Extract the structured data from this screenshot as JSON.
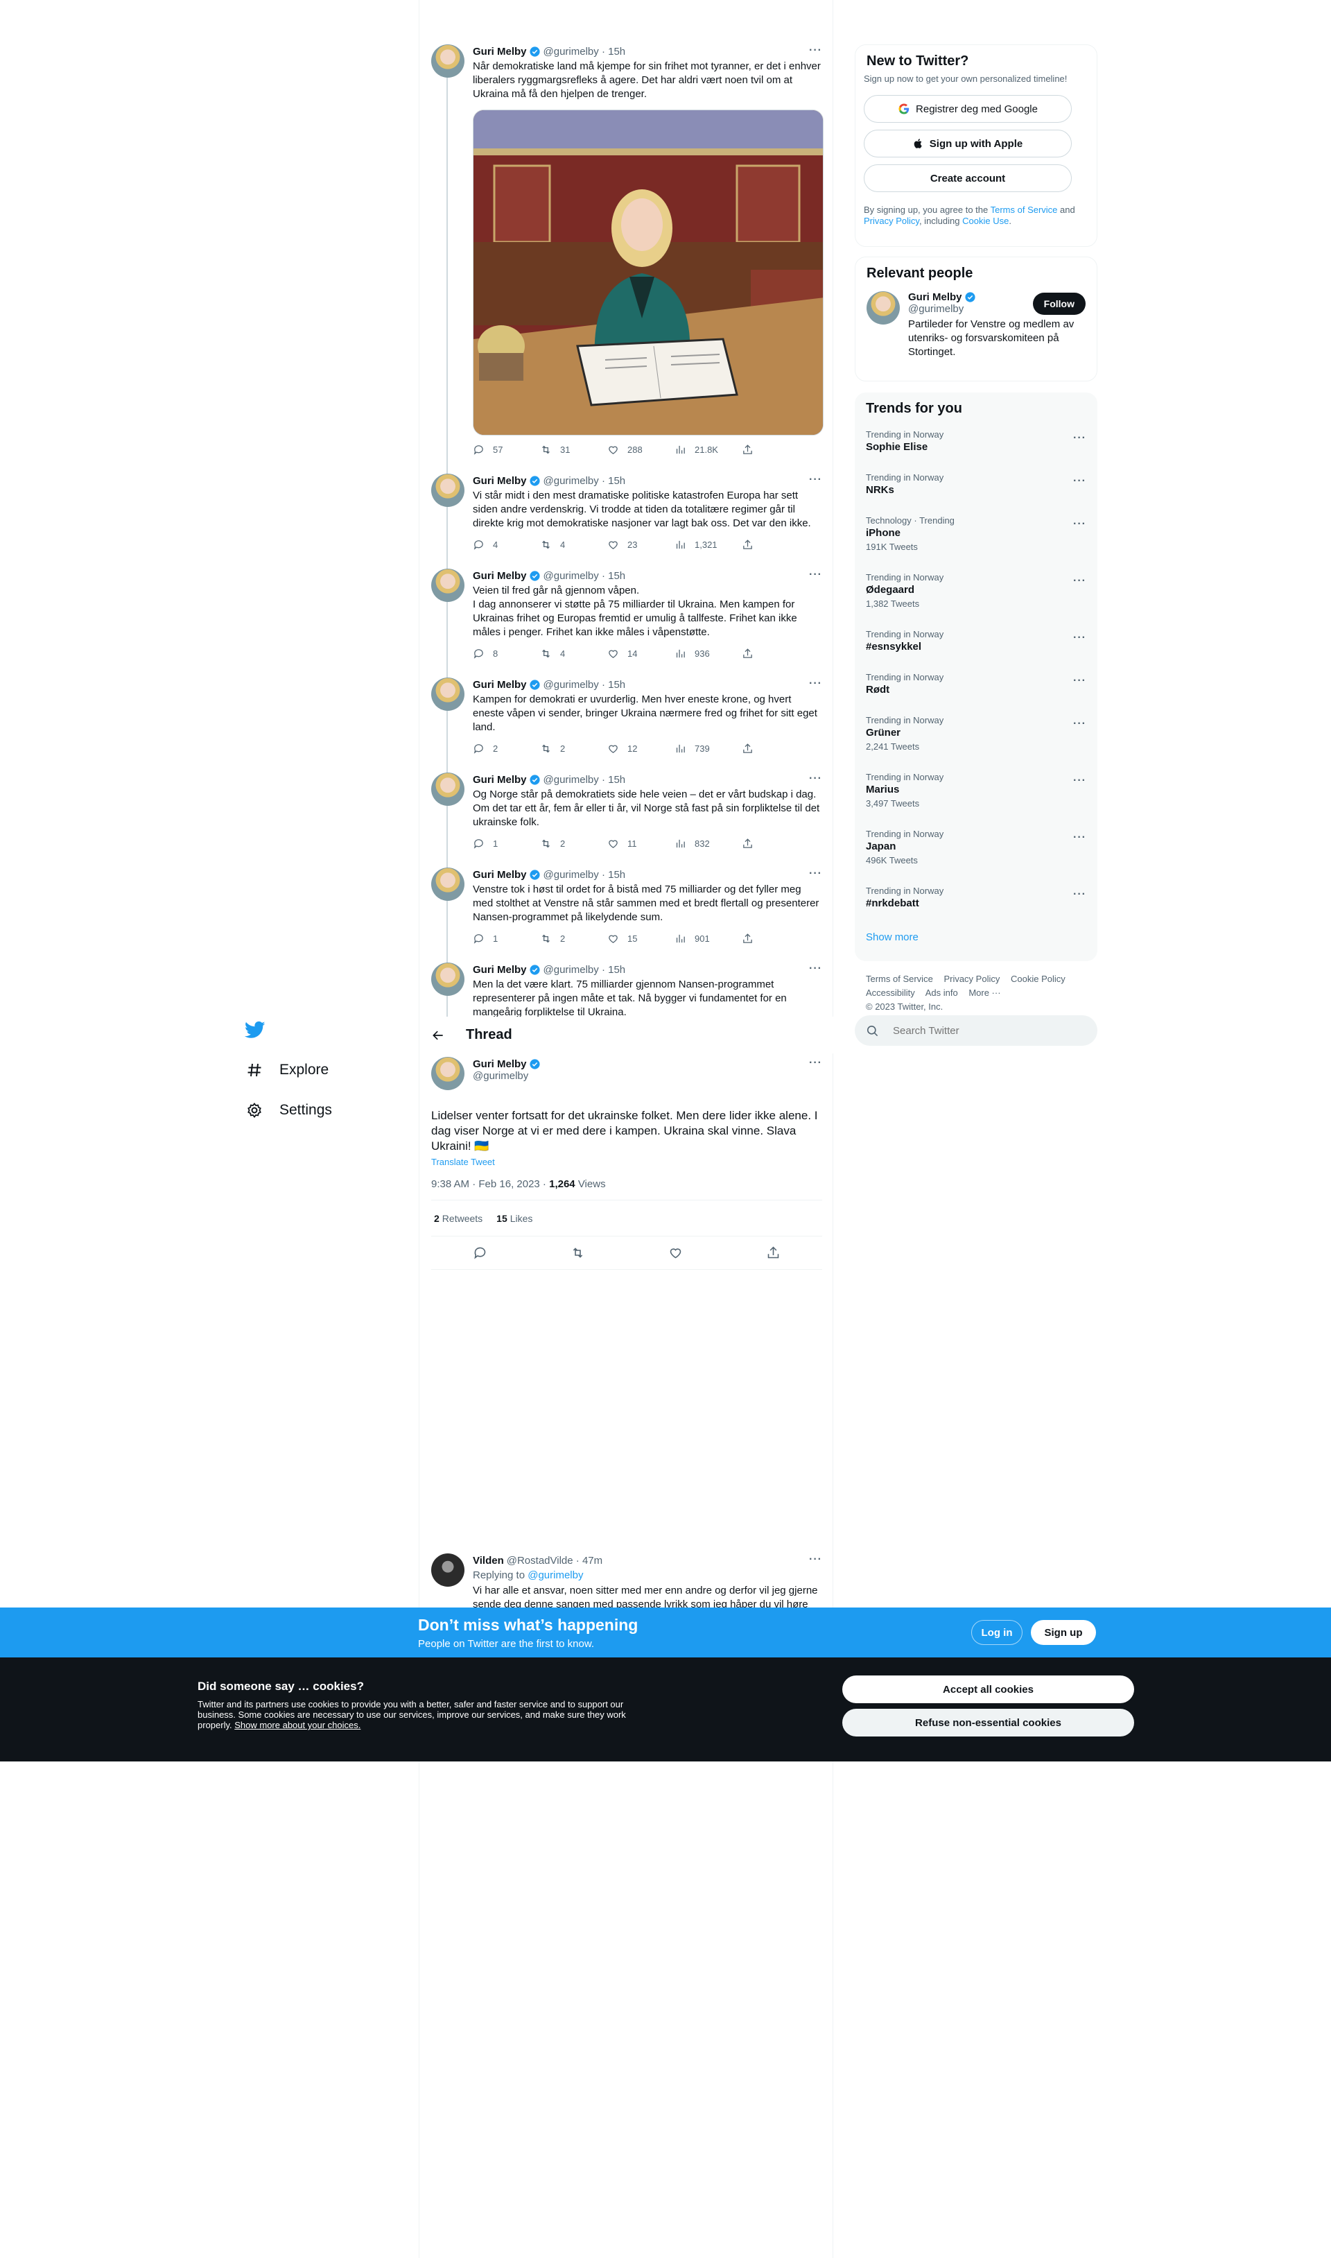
{
  "nav": {
    "items": [
      {
        "label": "Explore",
        "icon": "hashtag-icon"
      },
      {
        "label": "Settings",
        "icon": "gear-icon"
      }
    ]
  },
  "thread_tweets": [
    {
      "name": "Guri Melby",
      "handle": "@gurimelby",
      "time": "15h",
      "text": "Når demokratiske land må kjempe for sin frihet mot tyranner, er det i enhver liberalers ryggmargsrefleks å agere. Det har aldri vært noen tvil om at Ukraina må få den hjelpen de trenger.",
      "replies": "57",
      "retweets": "31",
      "likes": "288",
      "views": "21.8K",
      "has_photo": true
    },
    {
      "name": "Guri Melby",
      "handle": "@gurimelby",
      "time": "15h",
      "text": "Vi står midt i den mest dramatiske politiske katastrofen Europa har sett siden andre verdenskrig. Vi trodde at tiden da totalitære regimer går til direkte krig mot demokratiske nasjoner var lagt bak oss. Det var den ikke.",
      "replies": "4",
      "retweets": "4",
      "likes": "23",
      "views": "1,321"
    },
    {
      "name": "Guri Melby",
      "handle": "@gurimelby",
      "time": "15h",
      "text": "Veien til fred går nå gjennom våpen.\nI dag annonserer vi støtte på 75 milliarder til Ukraina. Men kampen for Ukrainas frihet og Europas fremtid er umulig å tallfeste. Frihet kan ikke måles i penger. Frihet kan ikke måles i våpenstøtte.",
      "replies": "8",
      "retweets": "4",
      "likes": "14",
      "views": "936"
    },
    {
      "name": "Guri Melby",
      "handle": "@gurimelby",
      "time": "15h",
      "text": "Kampen for demokrati er uvurderlig. Men hver eneste krone, og hvert eneste våpen vi sender, bringer Ukraina nærmere fred og frihet for sitt eget land.",
      "replies": "2",
      "retweets": "2",
      "likes": "12",
      "views": "739"
    },
    {
      "name": "Guri Melby",
      "handle": "@gurimelby",
      "time": "15h",
      "text": "Og Norge står på demokratiets side hele veien – det er vårt budskap i dag. Om det tar ett år, fem år eller ti år, vil Norge stå fast på sin forpliktelse til det ukrainske folk.",
      "replies": "1",
      "retweets": "2",
      "likes": "11",
      "views": "832"
    },
    {
      "name": "Guri Melby",
      "handle": "@gurimelby",
      "time": "15h",
      "text": "Venstre tok i høst til ordet for å bistå med 75 milliarder og det fyller meg med stolthet at Venstre nå står sammen med et bredt flertall og presenterer Nansen-programmet på likelydende sum.",
      "replies": "1",
      "retweets": "2",
      "likes": "15",
      "views": "901"
    },
    {
      "name": "Guri Melby",
      "handle": "@gurimelby",
      "time": "15h",
      "text": "Men la det være klart. 75 milliarder gjennom Nansen-programmet representerer på ingen måte et tak. Nå bygger vi fundamentet for en mangeårig forpliktelse til Ukraina.",
      "replies": "",
      "retweets": "",
      "likes": "",
      "views": ""
    }
  ],
  "thread": {
    "header": "Thread",
    "name": "Guri Melby",
    "handle": "@gurimelby",
    "text": "Lidelser venter fortsatt for det ukrainske folket. Men dere lider ikke alene. I dag viser Norge at vi er med dere i kampen. Ukraina skal vinne. Slava Ukraini! 🇺🇦",
    "translate": "Translate Tweet",
    "time": "9:38 AM · Feb 16, 2023 · ",
    "views_count": "1,264",
    "views_label": " Views",
    "retweets_count": "2",
    "retweets_label": "Retweets",
    "likes_count": "15",
    "likes_label": "Likes"
  },
  "reply": {
    "name": "Vilden",
    "handle": "@RostadVilde",
    "time": "47m",
    "replying_prefix": "Replying to ",
    "replying_to": "@gurimelby",
    "text": "Vi har alle et ansvar, noen sitter med mer enn andre og derfor vil jeg gjerne sende deg denne sangen med passende lyrikk som jeg håper du vil høre på"
  },
  "sidebar": {
    "new": {
      "title": "New to Twitter?",
      "subtitle": "Sign up now to get your own personalized timeline!",
      "google_btn": "Registrer deg med Google",
      "apple_btn": "Sign up with Apple",
      "create_btn": "Create account",
      "legal_prefix": "By signing up, you agree to the ",
      "terms": "Terms of Service",
      "and": " and ",
      "privacy": "Privacy Policy",
      "including": ", including ",
      "cookie": "Cookie Use",
      "end": "."
    },
    "relevant": {
      "title": "Relevant people",
      "name": "Guri Melby",
      "handle": "@gurimelby",
      "bio": "Partileder for Venstre og medlem av utenriks- og forsvarskomiteen på Stortinget.",
      "follow": "Follow"
    },
    "trends": {
      "title": "Trends for you",
      "items": [
        {
          "meta": "Trending in Norway",
          "name": "Sophie Elise",
          "count": ""
        },
        {
          "meta": "Trending in Norway",
          "name": "NRKs",
          "count": ""
        },
        {
          "meta": "Technology · Trending",
          "name": "iPhone",
          "count": "191K Tweets"
        },
        {
          "meta": "Trending in Norway",
          "name": "Ødegaard",
          "count": "1,382 Tweets"
        },
        {
          "meta": "Trending in Norway",
          "name": "#esnsykkel",
          "count": ""
        },
        {
          "meta": "Trending in Norway",
          "name": "Rødt",
          "count": ""
        },
        {
          "meta": "Trending in Norway",
          "name": "Grüner",
          "count": "2,241 Tweets"
        },
        {
          "meta": "Trending in Norway",
          "name": "Marius",
          "count": "3,497 Tweets"
        },
        {
          "meta": "Trending in Norway",
          "name": "Japan",
          "count": "496K Tweets"
        },
        {
          "meta": "Trending in Norway",
          "name": "#nrkdebatt",
          "count": ""
        }
      ],
      "show_more": "Show more"
    },
    "footer": {
      "terms": "Terms of Service",
      "privacy": "Privacy Policy",
      "cookie": "Cookie Policy",
      "accessibility": "Accessibility",
      "ads": "Ads info",
      "more": "More ···",
      "copyright": "© 2023 Twitter, Inc."
    },
    "search_placeholder": "Search Twitter"
  },
  "banner": {
    "title": "Don’t miss what’s happening",
    "subtitle": "People on Twitter are the first to know.",
    "login": "Log in",
    "signup": "Sign up"
  },
  "cookie": {
    "title": "Did someone say … cookies?",
    "text": "Twitter and its partners use cookies to provide you with a better, safer and faster service and to support our business. Some cookies are necessary to use our services, improve our services, and make sure they work properly. ",
    "link": "Show more about your choices.",
    "accept": "Accept all cookies",
    "refuse": "Refuse non-essential cookies"
  },
  "colors": {
    "accent": "#1d9bf0",
    "text": "#0f1419",
    "muted": "#536471",
    "border": "#eff3f4",
    "dark": "#0f1419"
  }
}
